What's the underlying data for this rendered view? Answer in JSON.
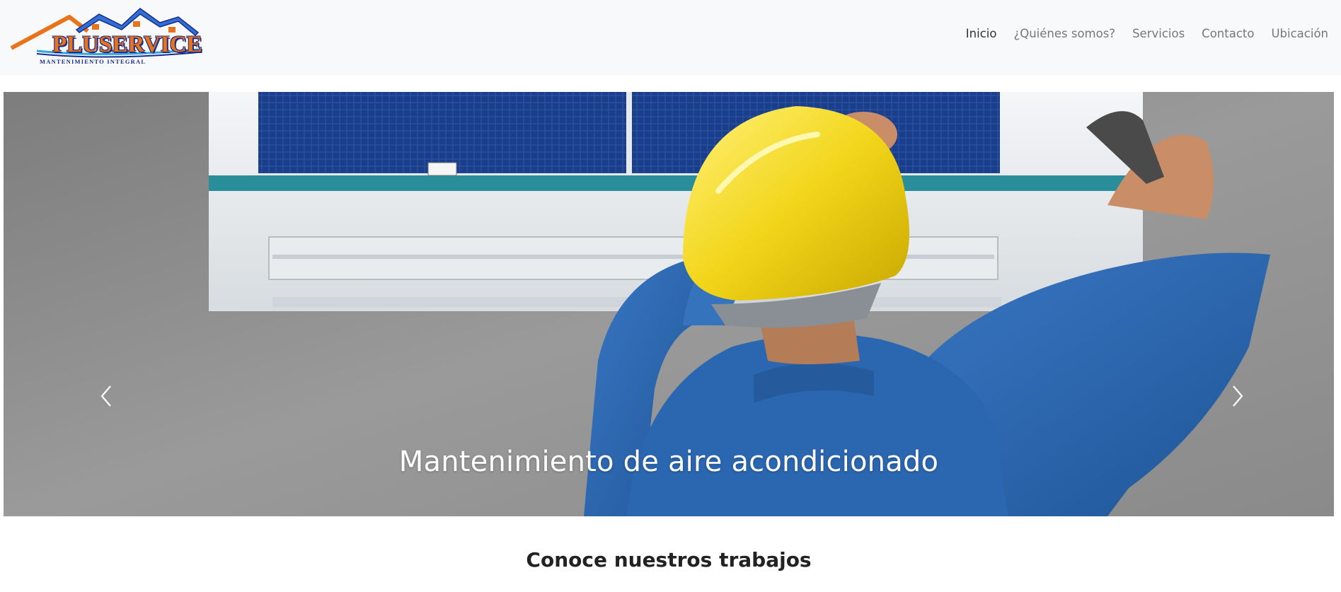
{
  "brand": {
    "name": "PLUSERVICE",
    "tagline": "MANTENIMIENTO INTEGRAL",
    "colors": {
      "orange": "#e8731a",
      "navy": "#1a2c8c",
      "blue": "#2f6fd6"
    }
  },
  "nav": {
    "items": [
      {
        "label": "Inicio",
        "active": true
      },
      {
        "label": "¿Quiénes somos?",
        "active": false
      },
      {
        "label": "Servicios",
        "active": false
      },
      {
        "label": "Contacto",
        "active": false
      },
      {
        "label": "Ubicación",
        "active": false
      }
    ]
  },
  "carousel": {
    "caption": "Mantenimiento de aire acondicionado",
    "prev_icon": "chevron-left-icon",
    "next_icon": "chevron-right-icon"
  },
  "section": {
    "title": "Conoce nuestros trabajos"
  }
}
